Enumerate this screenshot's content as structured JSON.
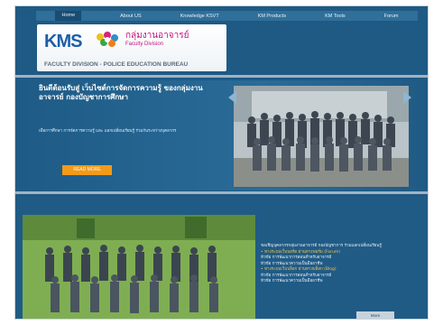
{
  "nav": {
    "items": [
      "Home",
      "About US",
      "Knowledge KSVT",
      "KM Products",
      "KM Tools",
      "Forum"
    ]
  },
  "brand": {
    "acronym": "KMS",
    "group_name": "กลุ่มงานอาจารย์",
    "faculty": "Faculty Division",
    "subtitle": "FACULTY DIVISION  -  POLICE EDUCATION BUREAU"
  },
  "hero": {
    "welcome": "ยินดีต้อนรับสู่ เว็บไซต์การจัดการความรู้ ของกลุ่มงานอาจารย์ กองบัญชาการศึกษา",
    "blurb": "เพื่อการศึกษา การจัดการความรู้ และ แลกเปลี่ยนเรียนรู้ ร่วมกันระหว่างบุคลากร",
    "read_more": "READ MORE"
  },
  "lower": {
    "info_title": "ขอเชิญบุคลากรกลุ่มงานอาจารย์ กองบัญชาการ ร่วมแลกเปลี่ยนเรียนรู้",
    "bullet1": "• ทางระบบเว็บบอร์ด ผ่านทางฟอรั่ม (Forum)",
    "line1": "หัวข้อ การพัฒนาการสอนสำหรับอาจารย์",
    "line2": "หัวข้อ การพัฒนาความเป็นมืออาชีพ",
    "bullet2": "• ทางระบบเว็บบล็อก ผ่านทางบล็อก (Blog)",
    "line3": "หัวข้อ การพัฒนาการสอนสำหรับอาจารย์",
    "line4": "หัวข้อ การพัฒนาความเป็นมืออาชีพ",
    "more": "More"
  },
  "colors": {
    "background": "#1f5a84",
    "accent": "#f29a1a",
    "brand_blue": "#1d5fa8",
    "brand_magenta": "#c4127e"
  }
}
